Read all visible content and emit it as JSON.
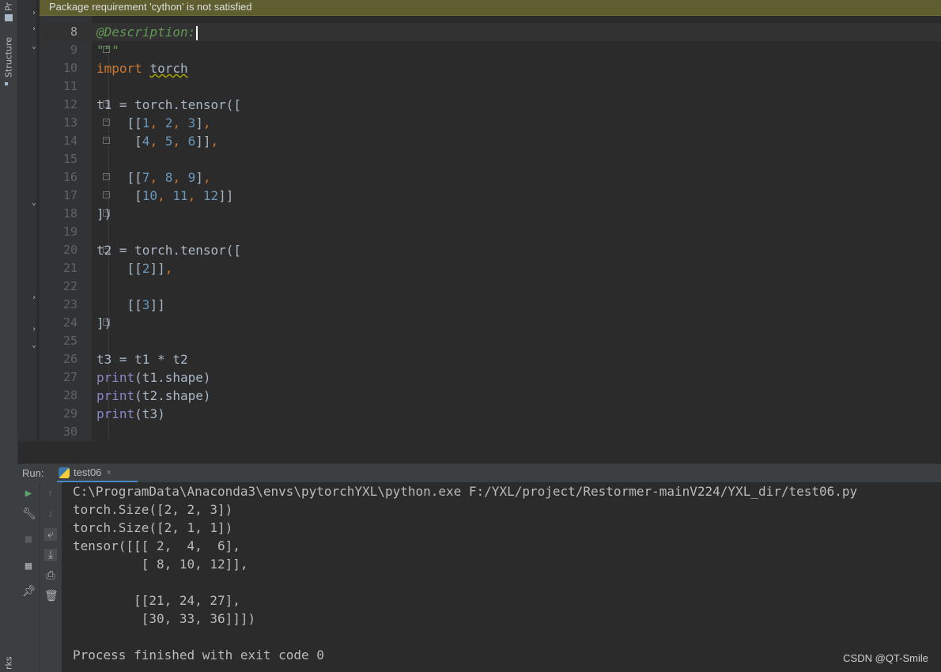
{
  "notification": {
    "text": "Package requirement 'cython' is not satisfied"
  },
  "left_strip": {
    "project_tab": "Pr",
    "structure_tab": "Structure",
    "bottom_tab": "rks"
  },
  "editor": {
    "lines": [
      {
        "number": "8",
        "tokens": [
          {
            "t": "@Description:",
            "c": "doc"
          }
        ],
        "current": true,
        "cursor": true
      },
      {
        "number": "9",
        "tokens": [
          {
            "t": "\"\"\"",
            "c": "doc"
          }
        ],
        "fold": true
      },
      {
        "number": "10",
        "tokens": [
          {
            "t": "import",
            "c": "kw"
          },
          {
            "t": " "
          },
          {
            "t": "torch",
            "c": "warn"
          }
        ]
      },
      {
        "number": "11",
        "tokens": []
      },
      {
        "number": "12",
        "tokens": [
          {
            "t": "t1 = torch.tensor(["
          }
        ],
        "fold": true
      },
      {
        "number": "13",
        "tokens": [
          {
            "t": "    [["
          },
          {
            "t": "1",
            "c": "num"
          },
          {
            "t": ", ",
            "c": "punc"
          },
          {
            "t": "2",
            "c": "num"
          },
          {
            "t": ", ",
            "c": "punc"
          },
          {
            "t": "3",
            "c": "num"
          },
          {
            "t": "]"
          },
          {
            "t": ",",
            "c": "punc"
          }
        ],
        "fold": true
      },
      {
        "number": "14",
        "tokens": [
          {
            "t": "     ["
          },
          {
            "t": "4",
            "c": "num"
          },
          {
            "t": ", ",
            "c": "punc"
          },
          {
            "t": "5",
            "c": "num"
          },
          {
            "t": ", ",
            "c": "punc"
          },
          {
            "t": "6",
            "c": "num"
          },
          {
            "t": "]]"
          },
          {
            "t": ",",
            "c": "punc"
          }
        ],
        "fold": true
      },
      {
        "number": "15",
        "tokens": []
      },
      {
        "number": "16",
        "tokens": [
          {
            "t": "    [["
          },
          {
            "t": "7",
            "c": "num"
          },
          {
            "t": ", ",
            "c": "punc"
          },
          {
            "t": "8",
            "c": "num"
          },
          {
            "t": ", ",
            "c": "punc"
          },
          {
            "t": "9",
            "c": "num"
          },
          {
            "t": "]"
          },
          {
            "t": ",",
            "c": "punc"
          }
        ],
        "fold": true
      },
      {
        "number": "17",
        "tokens": [
          {
            "t": "     ["
          },
          {
            "t": "10",
            "c": "num"
          },
          {
            "t": ", ",
            "c": "punc"
          },
          {
            "t": "11",
            "c": "num"
          },
          {
            "t": ", ",
            "c": "punc"
          },
          {
            "t": "12",
            "c": "num"
          },
          {
            "t": "]]"
          }
        ],
        "fold": true
      },
      {
        "number": "18",
        "tokens": [
          {
            "t": "])"
          }
        ],
        "fold": true
      },
      {
        "number": "19",
        "tokens": []
      },
      {
        "number": "20",
        "tokens": [
          {
            "t": "t2 = torch.tensor(["
          }
        ],
        "fold": true
      },
      {
        "number": "21",
        "tokens": [
          {
            "t": "    [["
          },
          {
            "t": "2",
            "c": "num"
          },
          {
            "t": "]]"
          },
          {
            "t": ",",
            "c": "punc"
          }
        ]
      },
      {
        "number": "22",
        "tokens": []
      },
      {
        "number": "23",
        "tokens": [
          {
            "t": "    [["
          },
          {
            "t": "3",
            "c": "num"
          },
          {
            "t": "]]"
          }
        ]
      },
      {
        "number": "24",
        "tokens": [
          {
            "t": "])"
          }
        ],
        "fold": true
      },
      {
        "number": "25",
        "tokens": []
      },
      {
        "number": "26",
        "tokens": [
          {
            "t": "t3 = t1 * t2"
          }
        ]
      },
      {
        "number": "27",
        "tokens": [
          {
            "t": "print",
            "c": "builtin"
          },
          {
            "t": "(t1.shape)"
          }
        ]
      },
      {
        "number": "28",
        "tokens": [
          {
            "t": "print",
            "c": "builtin"
          },
          {
            "t": "(t2.shape)"
          }
        ]
      },
      {
        "number": "29",
        "tokens": [
          {
            "t": "print",
            "c": "builtin"
          },
          {
            "t": "(t3)"
          }
        ]
      },
      {
        "number": "30",
        "tokens": []
      }
    ]
  },
  "run_panel": {
    "label": "Run:",
    "tab_label": "test06",
    "tab_close": "×",
    "output": [
      "C:\\ProgramData\\Anaconda3\\envs\\pytorchYXL\\python.exe F:/YXL/project/Restormer-mainV224/YXL_dir/test06.py",
      "torch.Size([2, 2, 3])",
      "torch.Size([2, 1, 1])",
      "tensor([[[ 2,  4,  6],",
      "         [ 8, 10, 12]],",
      "",
      "        [[21, 24, 27],",
      "         [30, 33, 36]]])",
      "",
      "Process finished with exit code 0"
    ]
  },
  "watermark": "CSDN @QT-Smile"
}
